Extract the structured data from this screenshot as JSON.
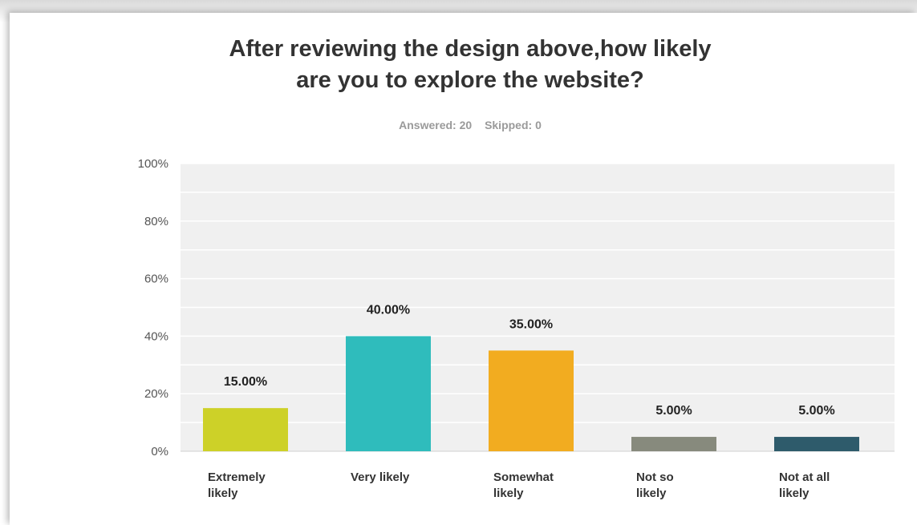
{
  "title_lines": [
    "After reviewing the design above,how likely",
    "are you to explore the website?"
  ],
  "stats": {
    "answered": "Answered: 20",
    "skipped": "Skipped: 0"
  },
  "chart_data": {
    "type": "bar",
    "title": "After reviewing the design above,how likely are you to explore the website?",
    "categories": [
      "Extremely likely",
      "Very likely",
      "Somewhat likely",
      "Not so likely",
      "Not at all likely"
    ],
    "category_lines": [
      [
        "Extremely",
        "likely"
      ],
      [
        "Very likely"
      ],
      [
        "Somewhat",
        "likely"
      ],
      [
        "Not so",
        "likely"
      ],
      [
        "Not at all",
        "likely"
      ]
    ],
    "values": [
      15,
      40,
      35,
      5,
      5
    ],
    "value_labels": [
      "15.00%",
      "40.00%",
      "35.00%",
      "5.00%",
      "5.00%"
    ],
    "colors": [
      "#cdd128",
      "#2fbcbc",
      "#f2ac20",
      "#878a7d",
      "#2e5b6b"
    ],
    "yticks": [
      "0%",
      "20%",
      "40%",
      "60%",
      "80%",
      "100%"
    ],
    "ylim": [
      0,
      100
    ],
    "grid": true,
    "background": "#f0f0f0"
  }
}
